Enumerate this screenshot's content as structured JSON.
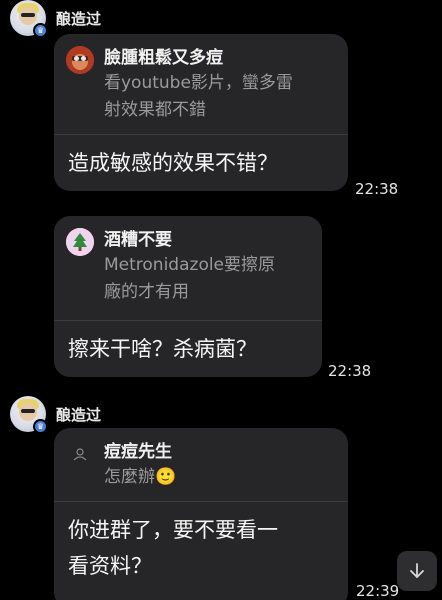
{
  "messages": [
    {
      "sender": "酿造过",
      "reply": {
        "name": "臉腫粗鬆又多痘",
        "text_line1": "看youtube影片，蠻多雷",
        "text_line2": "射效果都不錯"
      },
      "text": "造成敏感的效果不错？",
      "time": "22:38"
    },
    {
      "reply": {
        "name": "酒糟不要",
        "text_line1": "Metronidazole要擦原",
        "text_line2": "廠的才有用"
      },
      "text": "擦来干啥？杀病菌？",
      "time": "22:38"
    },
    {
      "sender": "酿造过",
      "reply": {
        "name": "痘痘先生",
        "text": "怎麼辦🙂"
      },
      "text_line1": "你进群了，要不要看一",
      "text_line2": "看资料？",
      "time": "22:39"
    }
  ],
  "icons": {
    "scroll_down": "arrow-down-icon",
    "badge": "verified-badge-icon"
  },
  "colors": {
    "background": "#000000",
    "bubble": "#262628",
    "reply_text": "#9a9a9c",
    "badge": "#4a7fd4"
  }
}
